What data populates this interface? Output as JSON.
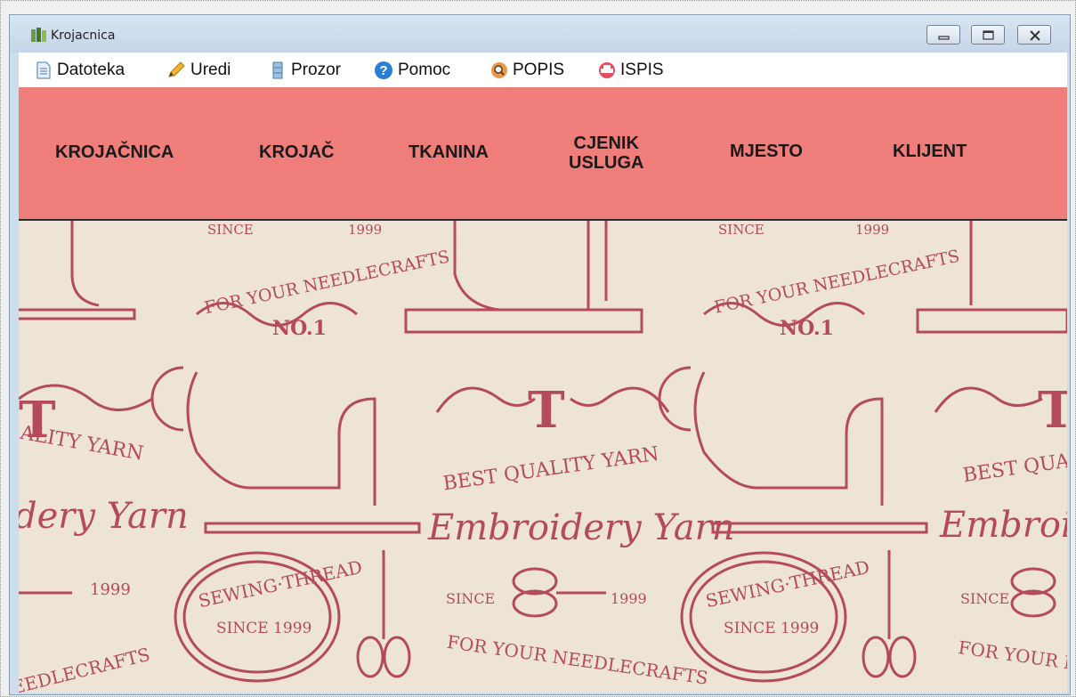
{
  "window": {
    "title": "Krojacnica"
  },
  "menu": [
    {
      "label": "Datoteka",
      "icon": "document-icon"
    },
    {
      "label": "Uredi",
      "icon": "pencil-icon"
    },
    {
      "label": "Prozor",
      "icon": "window-icon"
    },
    {
      "label": "Pomoc",
      "icon": "help-icon"
    },
    {
      "label": "POPIS",
      "icon": "search-icon"
    },
    {
      "label": "ISPIS",
      "icon": "printer-icon"
    }
  ],
  "nav": {
    "krojacnica": "KROJAČNICA",
    "krojac": "KROJAČ",
    "tkanina": "TKANINA",
    "cjenik_line1": "CJENIK",
    "cjenik_line2": "USLUGA",
    "mjesto": "MJESTO",
    "klijent": "KLIJENT"
  },
  "background_texts": {
    "since": "SINCE",
    "year": "1999",
    "needlecrafts": "FOR YOUR NEEDLECRAFTS",
    "no1": "NO.1",
    "best_quality": "BEST QUALITY YARN",
    "best_quali": "BEST QUALI",
    "ality_yarn": "ALITY YARN",
    "embroidery": "Embroidery Yarn",
    "embroide": "Embroide",
    "dery_yarn": "dery Yarn",
    "sewing_thread": "SEWING·THREAD",
    "since_1999": "SINCE 1999",
    "for_your_nee": "FOR YOUR NEE",
    "eedlecrafts": "EEDLECRAFTS",
    "t_letter": "T"
  },
  "colors": {
    "nav_background": "#ef7d7a",
    "pattern_ink": "#b54a5c",
    "pattern_paper": "#ede4d6"
  }
}
